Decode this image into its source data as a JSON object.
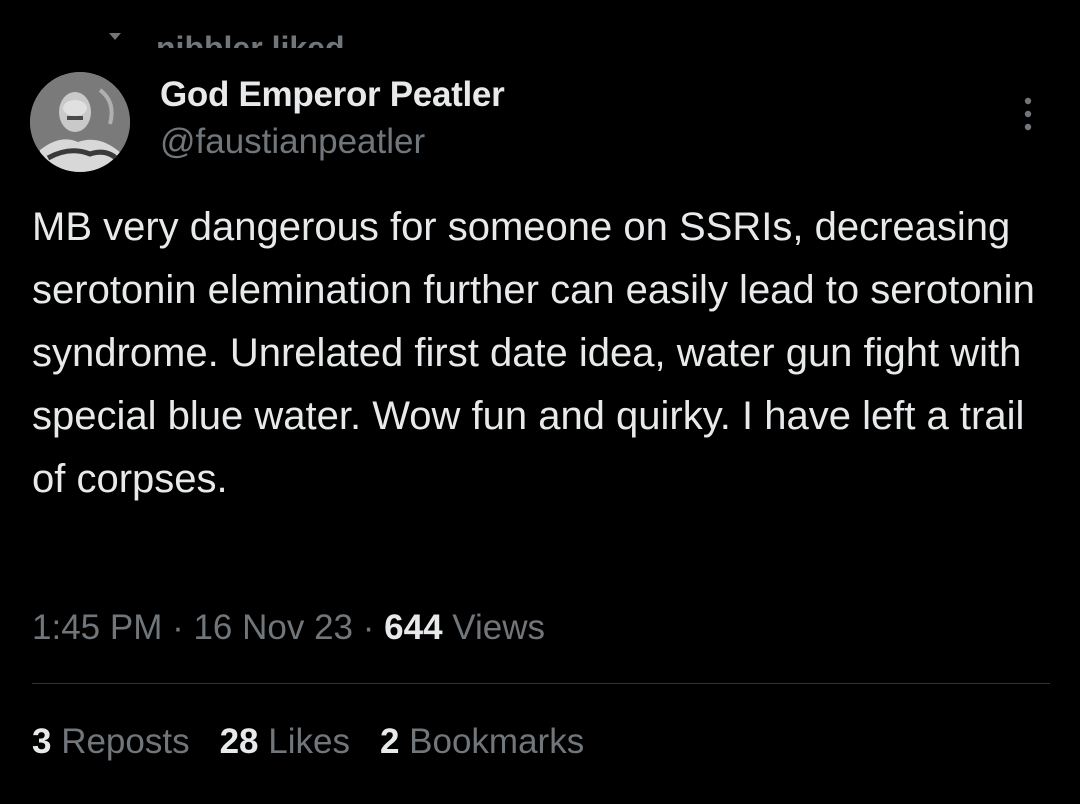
{
  "social_context": {
    "text": "nibbler liked",
    "icon": "heart-icon"
  },
  "author": {
    "display_name": "God Emperor Peatler",
    "handle": "@faustianpeatler",
    "avatar": "avatar-image"
  },
  "more_icon": "more-vertical-icon",
  "tweet": {
    "text": "MB very dangerous for someone on SSRIs, decreasing serotonin elemination further can easily lead to serotonin syndrome. Unrelated first date idea, water gun fight with special blue water. Wow fun and quirky. I have left a trail of corpses."
  },
  "meta": {
    "time": "1:45 PM",
    "sep1": " · ",
    "date": "16 Nov 23",
    "sep2": " · ",
    "views_count": "644",
    "views_label": " Views"
  },
  "engagement": {
    "reposts_count": "3",
    "reposts_label": " Reposts",
    "likes_count": "28",
    "likes_label": " Likes",
    "bookmarks_count": "2",
    "bookmarks_label": " Bookmarks"
  },
  "colors": {
    "background": "#000000",
    "primary_text": "#e7e9ea",
    "secondary_text": "#71767b",
    "divider": "#2f3336"
  }
}
